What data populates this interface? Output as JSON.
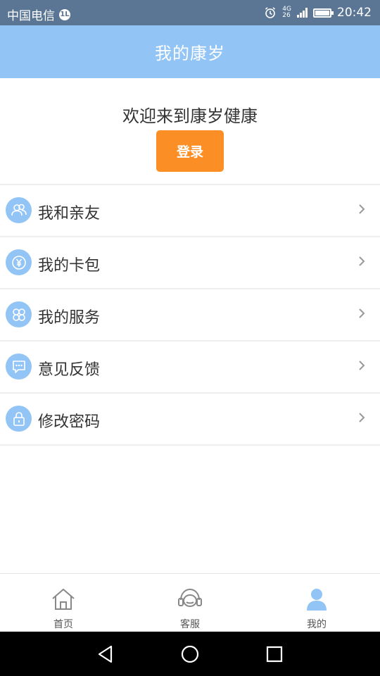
{
  "status_bar": {
    "carrier": "中国电信",
    "carrier_badge": "1L",
    "network": "4G",
    "network_sub": "26",
    "time": "20:42"
  },
  "header": {
    "title": "我的康岁"
  },
  "welcome": {
    "text": "欢迎来到康岁健康",
    "login_label": "登录"
  },
  "menu": {
    "items": [
      {
        "label": "我和亲友",
        "icon": "people-icon"
      },
      {
        "label": "我的卡包",
        "icon": "yuan-icon"
      },
      {
        "label": "我的服务",
        "icon": "clover-icon"
      },
      {
        "label": "意见反馈",
        "icon": "chat-icon"
      },
      {
        "label": "修改密码",
        "icon": "lock-icon"
      }
    ]
  },
  "tabbar": {
    "items": [
      {
        "label": "首页",
        "icon": "home-icon",
        "active": false
      },
      {
        "label": "客服",
        "icon": "headset-icon",
        "active": false
      },
      {
        "label": "我的",
        "icon": "user-icon",
        "active": true
      }
    ]
  },
  "colors": {
    "header_bg": "#92c4f6",
    "login_button": "#fb8f26",
    "status_bar_bg": "#5a7694",
    "icon_bg": "#92c4f6"
  }
}
